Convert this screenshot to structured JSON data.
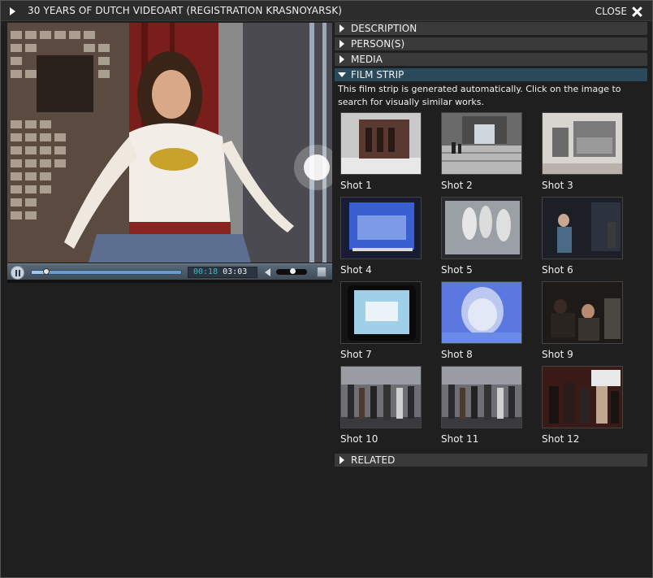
{
  "window": {
    "title": "30 YEARS OF DUTCH VIDEOART (REGISTRATION KRASNOYARSK)",
    "close_label": "CLOSE"
  },
  "player": {
    "current_time": "00:18",
    "total_time": "03:03",
    "progress_fraction": 0.098,
    "volume_fraction": 0.55,
    "state": "playing"
  },
  "sections": {
    "description": "DESCRIPTION",
    "persons": "PERSON(S)",
    "media": "MEDIA",
    "film_strip": "FILM STRIP",
    "related": "RELATED"
  },
  "film_strip": {
    "note": "This film strip is generated automatically. Click on the image to search for visually similar works.",
    "shots": [
      {
        "label": "Shot 1",
        "scene": "building"
      },
      {
        "label": "Shot 2",
        "scene": "steps"
      },
      {
        "label": "Shot 3",
        "scene": "gallery"
      },
      {
        "label": "Shot 4",
        "scene": "screen-blue"
      },
      {
        "label": "Shot 5",
        "scene": "projection"
      },
      {
        "label": "Shot 6",
        "scene": "person-dark"
      },
      {
        "label": "Shot 7",
        "scene": "tv"
      },
      {
        "label": "Shot 8",
        "scene": "face-blue"
      },
      {
        "label": "Shot 9",
        "scene": "audience"
      },
      {
        "label": "Shot 10",
        "scene": "crowd"
      },
      {
        "label": "Shot 11",
        "scene": "crowd"
      },
      {
        "label": "Shot 12",
        "scene": "crowd-red"
      }
    ]
  }
}
